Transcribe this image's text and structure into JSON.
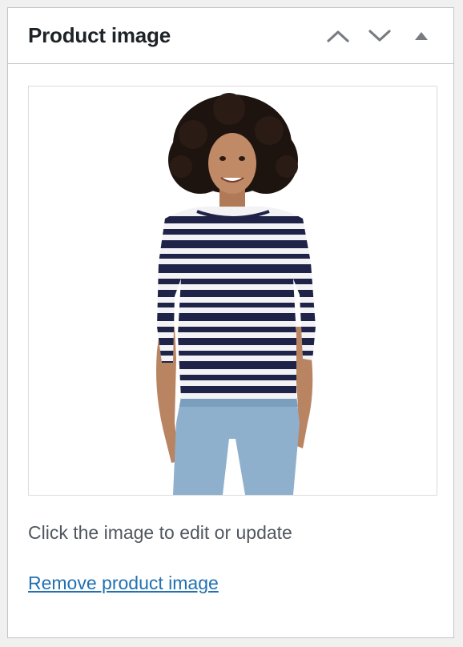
{
  "metabox": {
    "title": "Product image",
    "controls": {
      "move_up_icon": "chevron-up-icon",
      "move_down_icon": "chevron-down-icon",
      "toggle_icon": "triangle-up-icon"
    }
  },
  "product_image": {
    "alt": "Woman wearing navy and white striped long-sleeve top with light blue jeans",
    "hint": "Click the image to edit or update",
    "remove_label": "Remove product image"
  },
  "colors": {
    "link": "#2271b1",
    "border": "#c3c4c7",
    "stripe_navy": "#1f2347",
    "denim": "#8fb0cc"
  }
}
